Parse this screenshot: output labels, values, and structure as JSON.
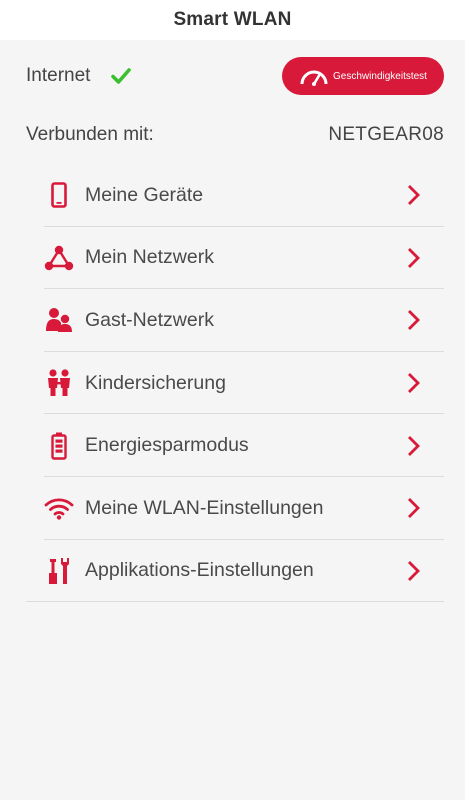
{
  "header": {
    "title": "Smart WLAN"
  },
  "status": {
    "internet_label": "Internet",
    "speedtest_label": "Geschwindigkeitstest",
    "connected_label": "Verbunden mit:",
    "connected_network": "NETGEAR08"
  },
  "menu": {
    "items": [
      {
        "label": "Meine Geräte",
        "icon": "phone-icon"
      },
      {
        "label": "Mein Netzwerk",
        "icon": "network-icon"
      },
      {
        "label": "Gast-Netzwerk",
        "icon": "guests-icon"
      },
      {
        "label": "Kindersicherung",
        "icon": "family-icon"
      },
      {
        "label": "Energiesparmodus",
        "icon": "battery-icon"
      },
      {
        "label": "Meine WLAN-Einstellungen",
        "icon": "wifi-icon"
      },
      {
        "label": "Applikations-Einstellungen",
        "icon": "tools-icon"
      }
    ]
  },
  "colors": {
    "accent": "#d8193a",
    "success": "#3bbf2e",
    "background": "#f5f5f5"
  }
}
